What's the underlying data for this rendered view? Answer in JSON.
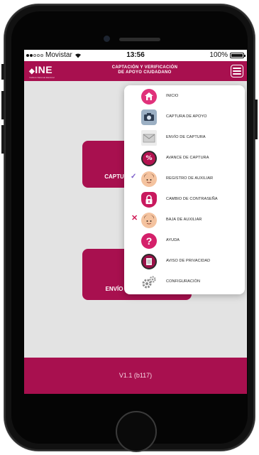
{
  "status_bar": {
    "carrier": "Movistar",
    "time": "13:56",
    "battery": "100%"
  },
  "header": {
    "logo_text": "INE",
    "logo_subtext": "Instituto Nacional Electoral",
    "title_line1": "CAPTACIÓN Y VERIFICACIÓN",
    "title_line2": "DE APOYO CIUDADANO",
    "menu_icon": "hamburger-icon"
  },
  "tiles": [
    {
      "label": "CAPTU"
    },
    {
      "label": "ENVÍO"
    }
  ],
  "footer": {
    "version": "V1.1 (b117)"
  },
  "menu": {
    "items": [
      {
        "label": "INICIO",
        "icon": "home-icon"
      },
      {
        "label": "CAPTURA DE APOYO",
        "icon": "camera-id-icon"
      },
      {
        "label": "ENVÍO DE CAPTURA",
        "icon": "envelope-icon"
      },
      {
        "label": "AVANCE DE CAPTURA",
        "icon": "percent-icon"
      },
      {
        "label": "REGISTRO DE AUXILIAR",
        "icon": "add-assistant-icon"
      },
      {
        "label": "CAMBIO DE CONTRASEÑA",
        "icon": "lock-icon"
      },
      {
        "label": "BAJA DE AUXILIAR",
        "icon": "remove-assistant-icon"
      },
      {
        "label": "AYUDA",
        "icon": "help-icon"
      },
      {
        "label": "AVISO DE PRIVACIDAD",
        "icon": "privacy-document-icon"
      },
      {
        "label": "CONFIGURACIÓN",
        "icon": "gears-icon"
      }
    ]
  },
  "colors": {
    "brand": "#a8104f",
    "accent_pink": "#e0317a",
    "background": "#e3e3e3"
  }
}
